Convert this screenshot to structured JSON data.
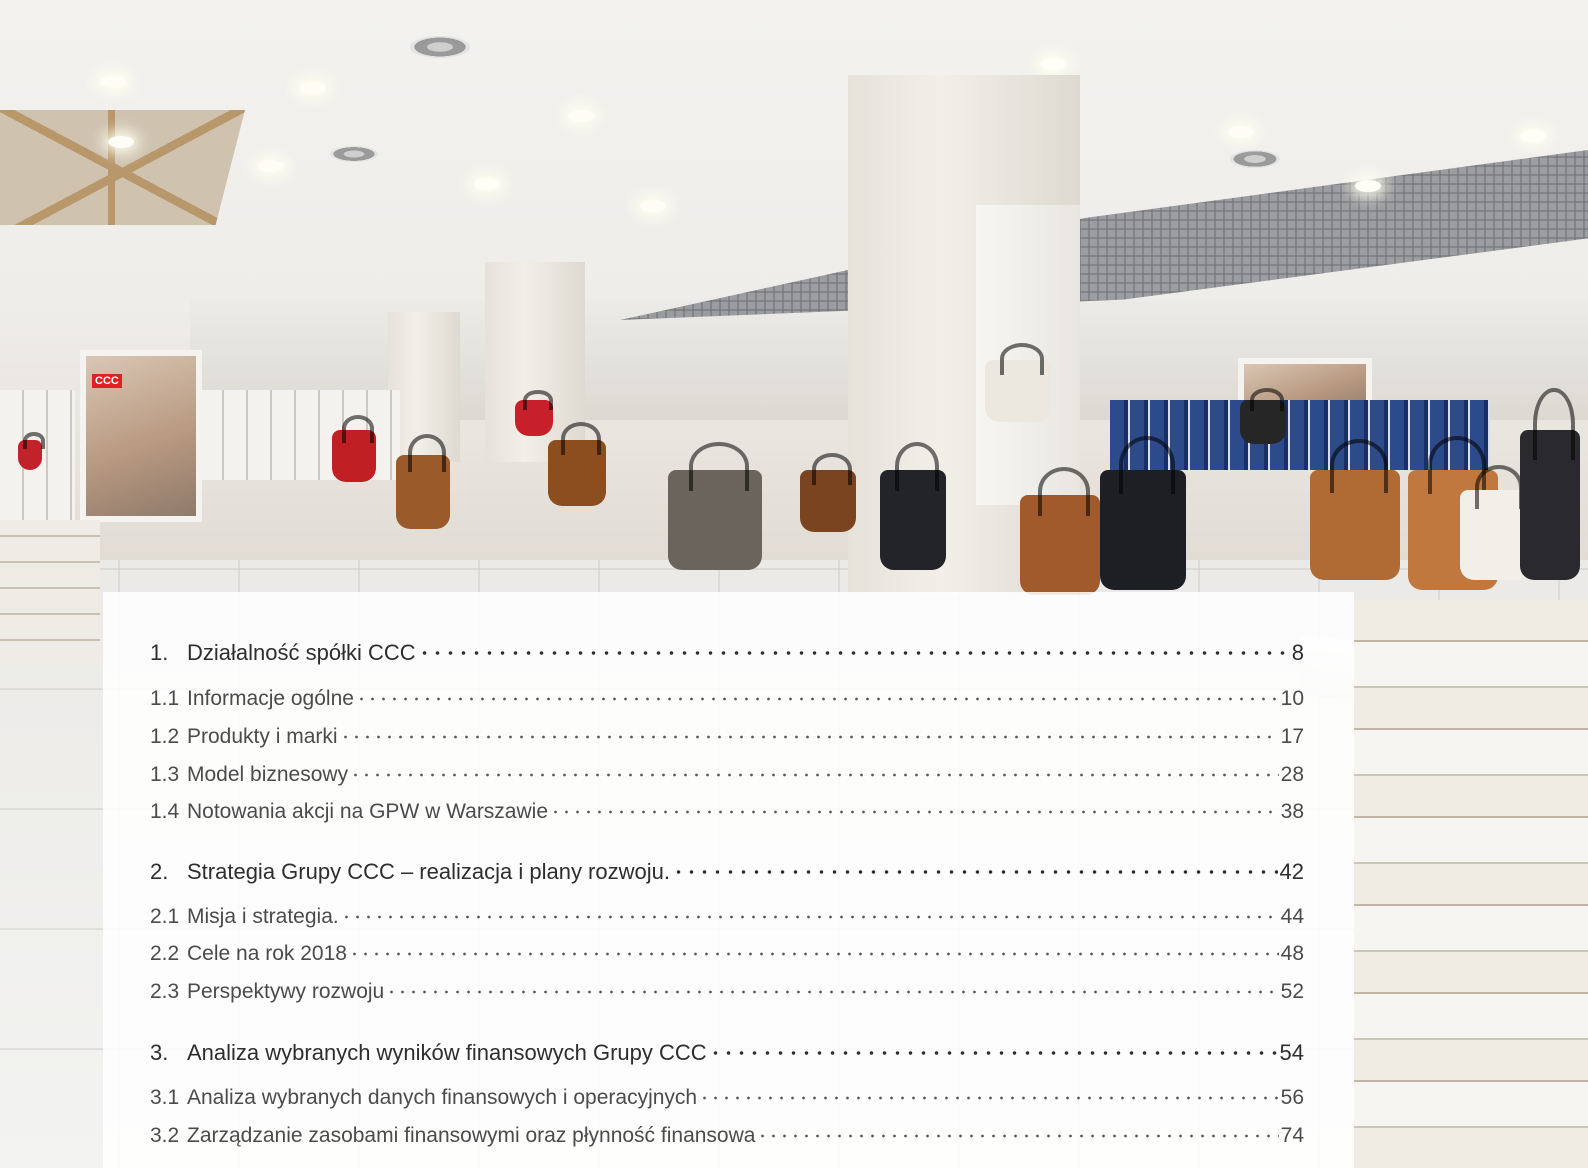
{
  "toc": {
    "entries": [
      {
        "num": "1.",
        "title": "Działalność spółki CCC",
        "page": "8",
        "level": "chapter"
      },
      {
        "num": "1.1",
        "title": "Informacje ogólne",
        "page": "10",
        "level": "section"
      },
      {
        "num": "1.2",
        "title": "Produkty i marki",
        "page": "17",
        "level": "section"
      },
      {
        "num": "1.3",
        "title": "Model biznesowy",
        "page": "28",
        "level": "section"
      },
      {
        "num": "1.4",
        "title": "Notowania akcji na GPW w Warszawie",
        "page": "38",
        "level": "section"
      },
      {
        "num": "2.",
        "title": "Strategia Grupy CCC – realizacja i plany rozwoju.",
        "page": "42",
        "level": "chapter"
      },
      {
        "num": "2.1",
        "title": "Misja i strategia.",
        "page": "44",
        "level": "section"
      },
      {
        "num": "2.2",
        "title": "Cele na rok 2018",
        "page": "48",
        "level": "section"
      },
      {
        "num": "2.3",
        "title": "Perspektywy rozwoju",
        "page": "52",
        "level": "section"
      },
      {
        "num": "3.",
        "title": "Analiza wybranych wyników finansowych Grupy CCC",
        "page": "54",
        "level": "chapter"
      },
      {
        "num": "3.1",
        "title": "Analiza wybranych danych finansowych i operacyjnych",
        "page": "56",
        "level": "section"
      },
      {
        "num": "3.2",
        "title": "Zarządzanie zasobami finansowymi oraz płynność finansowa",
        "page": "74",
        "level": "section"
      }
    ]
  },
  "photo": {
    "poster_logo": "CCC"
  }
}
